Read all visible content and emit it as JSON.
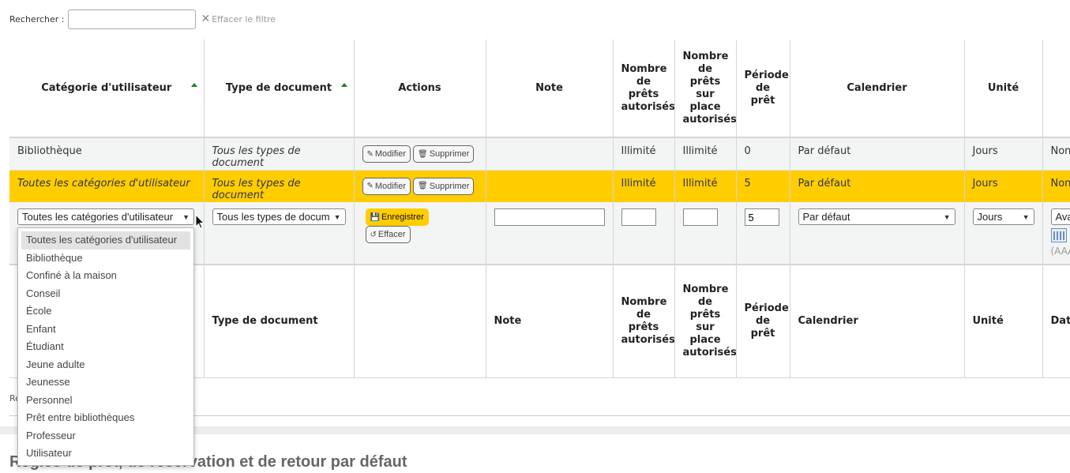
{
  "search": {
    "label": "Rechercher :",
    "value": "",
    "clear_filter": "Effacer le filtre"
  },
  "headers": {
    "categorie": "Catégorie d'utilisateur",
    "type": "Type de document",
    "actions": "Actions",
    "note": "Note",
    "nb_prets": "Nombre de prêts autorisés",
    "nb_sur_place": "Nombre de prêts sur place autorisés",
    "periode": "Période de prêt",
    "calendrier": "Calendrier",
    "unite": "Unité"
  },
  "rows": [
    {
      "categorie": "Bibliothèque",
      "type": "Tous les types de document",
      "modify": "Modifier",
      "delete": "Supprimer",
      "note": "",
      "nb_prets": "Illimité",
      "nb_sur_place": "Illimité",
      "periode": "0",
      "calendrier": "Par défaut",
      "unite": "Jours",
      "extra": "Non"
    },
    {
      "categorie": "Toutes les catégories d'utilisateur",
      "type": "Tous les types de document",
      "modify": "Modifier",
      "delete": "Supprimer",
      "note": "",
      "nb_prets": "Illimité",
      "nb_sur_place": "Illimité",
      "periode": "5",
      "calendrier": "Par défaut",
      "unite": "Jours",
      "extra": "Non"
    }
  ],
  "edit_row": {
    "categorie": "Toutes les catégories d'utilisateur",
    "type": "Tous les types de docum",
    "save": "Enregistrer",
    "reset": "Effacer",
    "note": "",
    "nb_prets": "",
    "nb_sur_place": "",
    "periode": "5",
    "calendrier": "Par défaut",
    "unite": "Jours",
    "extra": "Ava",
    "date_hint": "(AAA"
  },
  "footer": {
    "type": "Type de document",
    "note": "Note",
    "nb_prets": "Nombre de prêts autorisés",
    "nb_sur_place": "Nombre de prêts sur place autorisés",
    "periode": "Période de prêt",
    "calendrier": "Calendrier",
    "unite": "Unité",
    "extra": "Date"
  },
  "dropdown_options": [
    "Toutes les catégories d'utilisateur",
    "Bibliothèque",
    "Confiné à la maison",
    "Conseil",
    "École",
    "Enfant",
    "Étudiant",
    "Jeune adulte",
    "Jeunesse",
    "Personnel",
    "Prêt entre bibliothèques",
    "Professeur",
    "Utilisateur"
  ],
  "rows_info": "Re",
  "section_title": "Règles de prêt, de réservation et de retour par défaut",
  "colors": {
    "highlight": "#ffcd00",
    "sort_arrow": "#207b2a"
  }
}
